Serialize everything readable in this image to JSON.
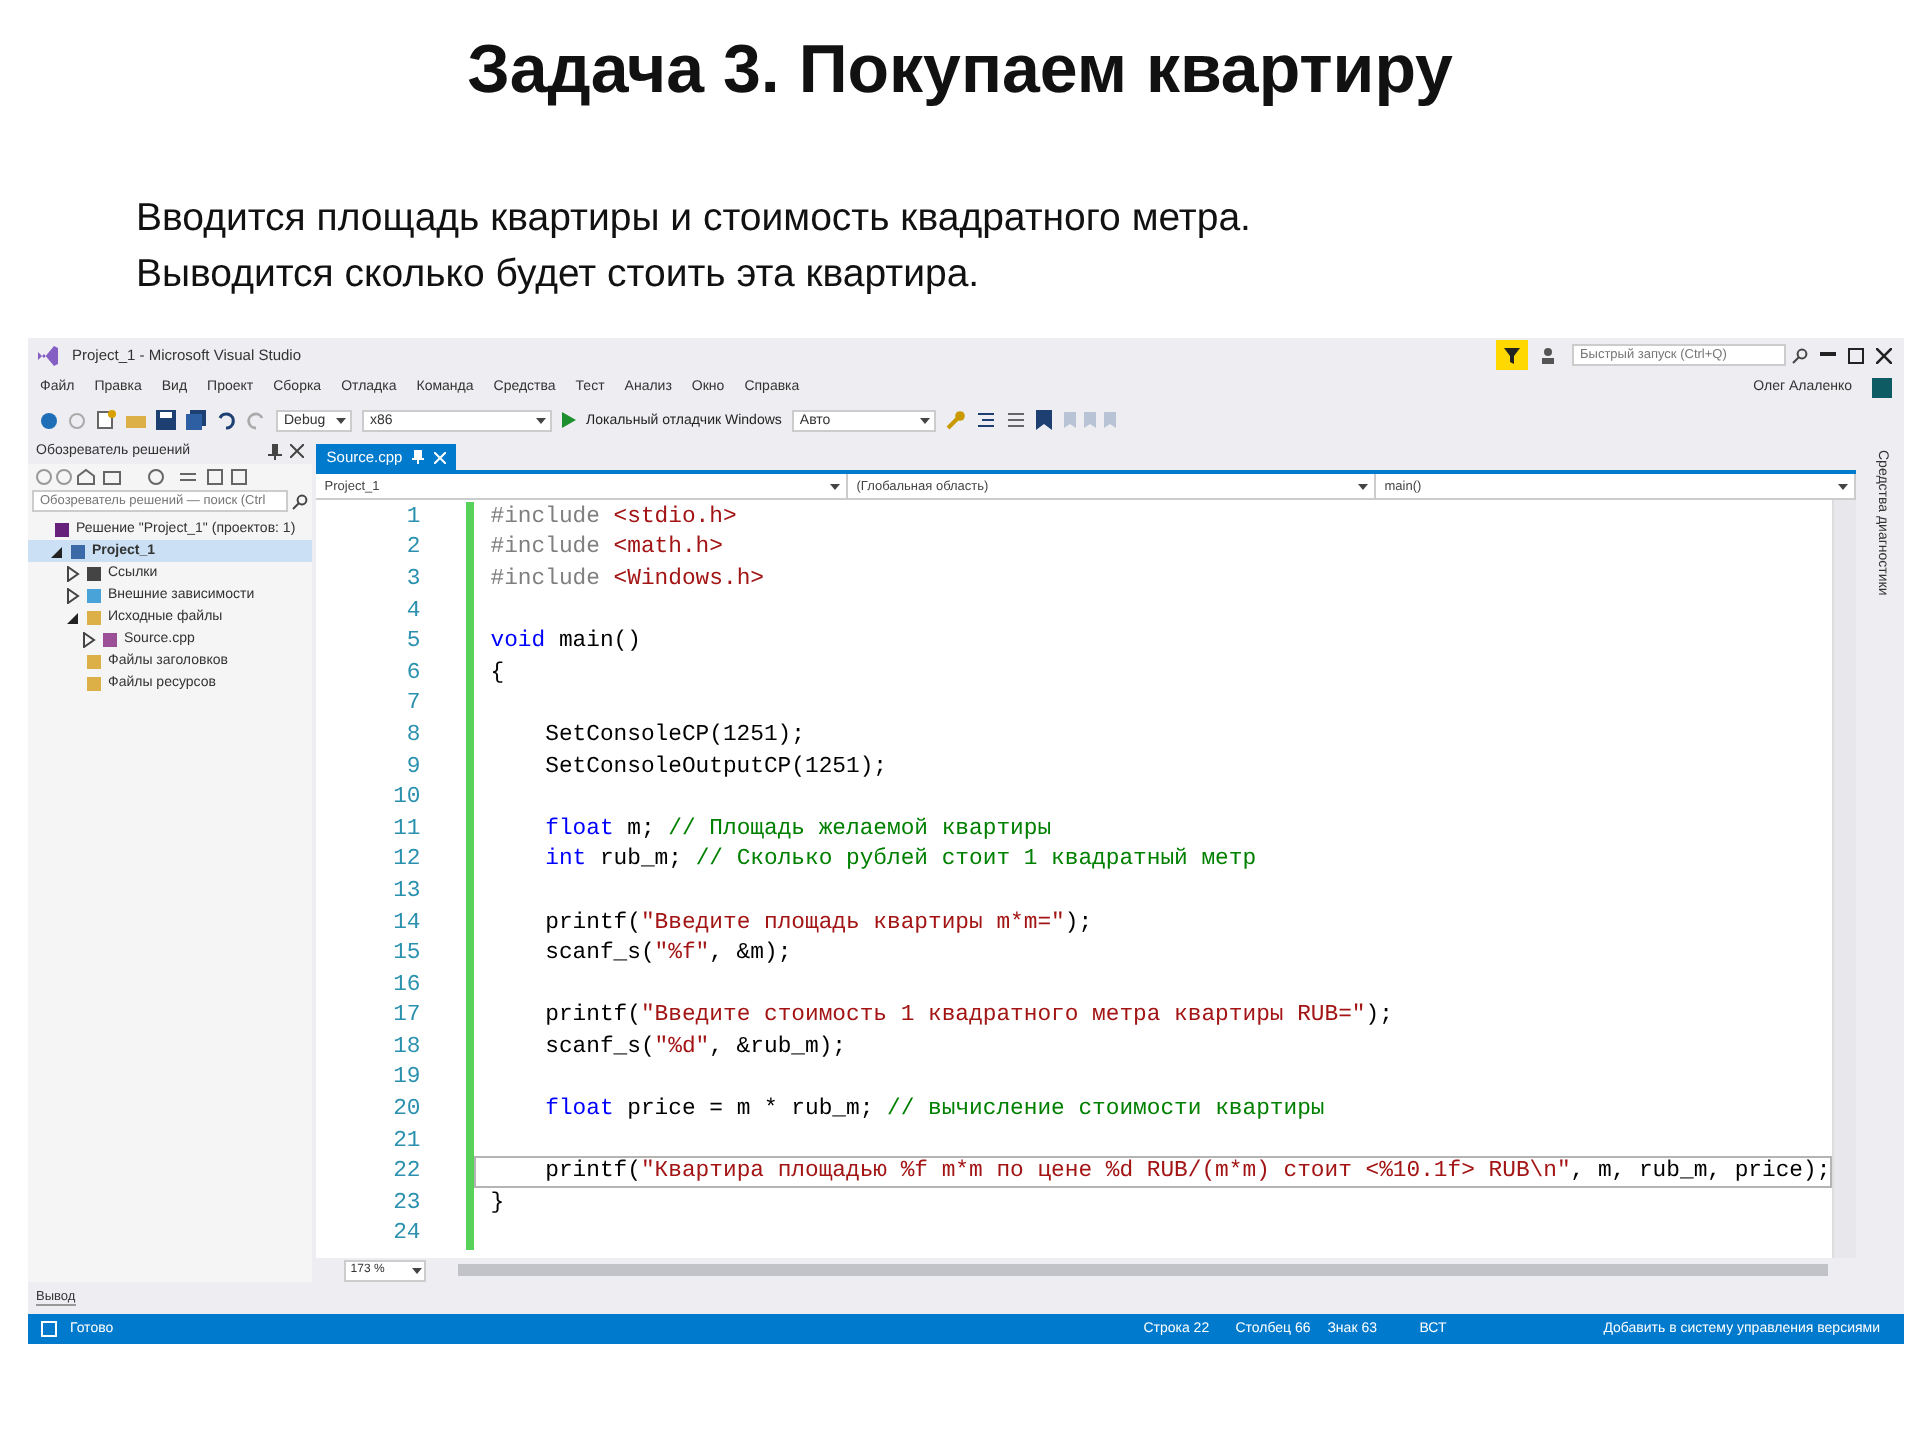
{
  "slide": {
    "title": "Задача 3. Покупаем квартиру",
    "lines": [
      "Вводится площадь квартиры и стоимость квадратного метра.",
      "Выводится сколько будет стоить эта квартира."
    ]
  },
  "window": {
    "title": "Project_1 - Microsoft Visual Studio",
    "quick_launch": {
      "placeholder": "Быстрый запуск (Ctrl+Q)"
    },
    "user": "Олег Алаленко"
  },
  "menu": [
    "Файл",
    "Правка",
    "Вид",
    "Проект",
    "Сборка",
    "Отладка",
    "Команда",
    "Средства",
    "Тест",
    "Анализ",
    "Окно",
    "Справка"
  ],
  "toolbar": {
    "configuration": "Debug",
    "platform": "x86",
    "debugger": "Локальный отладчик Windows",
    "mode": "Авто"
  },
  "solution_explorer": {
    "title": "Обозреватель решений",
    "search": {
      "placeholder": "Обозреватель решений — поиск (Ctrl"
    },
    "tree": [
      {
        "label": "Решение \"Project_1\" (проектов: 1)",
        "kind": "solution",
        "selected": false,
        "children": [
          {
            "label": "Project_1",
            "kind": "project",
            "expanded": true,
            "selected": true,
            "children": [
              {
                "label": "Ссылки",
                "kind": "references",
                "expanded": false,
                "selected": false
              },
              {
                "label": "Внешние зависимости",
                "kind": "external",
                "expanded": false,
                "selected": false
              },
              {
                "label": "Исходные файлы",
                "kind": "folder",
                "expanded": true,
                "selected": false,
                "children": [
                  {
                    "label": "Source.cpp",
                    "kind": "file",
                    "expanded": false,
                    "selected": false
                  }
                ]
              },
              {
                "label": "Файлы заголовков",
                "kind": "folder",
                "selected": false
              },
              {
                "label": "Файлы ресурсов",
                "kind": "folder",
                "selected": false
              }
            ]
          }
        ]
      }
    ]
  },
  "editor": {
    "tabs": [
      {
        "label": "Source.cpp",
        "selected": true
      }
    ],
    "navigation": {
      "project": "Project_1",
      "scope": "(Глобальная область)",
      "member": "main()"
    },
    "lines": [
      {
        "number": "1",
        "current": false,
        "segments": [
          {
            "kind": "pre",
            "text": "#include "
          },
          {
            "kind": "str",
            "text": "<stdio.h>"
          }
        ]
      },
      {
        "number": "2",
        "current": false,
        "segments": [
          {
            "kind": "pre",
            "text": "#include "
          },
          {
            "kind": "str",
            "text": "<math.h>"
          }
        ]
      },
      {
        "number": "3",
        "current": false,
        "segments": [
          {
            "kind": "pre",
            "text": "#include "
          },
          {
            "kind": "str",
            "text": "<Windows.h>"
          }
        ]
      },
      {
        "number": "4",
        "current": false
      },
      {
        "number": "5",
        "current": false,
        "segments": [
          {
            "kind": "kw",
            "text": "void"
          },
          {
            "kind": "plain",
            "text": " main()"
          }
        ]
      },
      {
        "number": "6",
        "current": false,
        "segments": [
          {
            "kind": "plain",
            "text": "{"
          }
        ]
      },
      {
        "number": "7",
        "current": false
      },
      {
        "number": "8",
        "current": false,
        "segments": [
          {
            "kind": "plain",
            "text": "    SetConsoleCP(1251);"
          }
        ]
      },
      {
        "number": "9",
        "current": false,
        "segments": [
          {
            "kind": "plain",
            "text": "    SetConsoleOutputCP(1251);"
          }
        ]
      },
      {
        "number": "10",
        "current": false
      },
      {
        "number": "11",
        "current": false,
        "segments": [
          {
            "kind": "kw",
            "text": "    float"
          },
          {
            "kind": "plain",
            "text": " m; "
          },
          {
            "kind": "com",
            "text": "// Площадь желаемой квартиры"
          }
        ]
      },
      {
        "number": "12",
        "current": false,
        "segments": [
          {
            "kind": "kw",
            "text": "    int"
          },
          {
            "kind": "plain",
            "text": " rub_m; "
          },
          {
            "kind": "com",
            "text": "// Сколько рублей стоит 1 квадратный метр"
          }
        ]
      },
      {
        "number": "13",
        "current": false
      },
      {
        "number": "14",
        "current": false,
        "segments": [
          {
            "kind": "plain",
            "text": "    printf("
          },
          {
            "kind": "str",
            "text": "\"Введите площадь квартиры m*m=\""
          },
          {
            "kind": "plain",
            "text": ");"
          }
        ]
      },
      {
        "number": "15",
        "current": false,
        "segments": [
          {
            "kind": "plain",
            "text": "    scanf_s("
          },
          {
            "kind": "str",
            "text": "\"%f\""
          },
          {
            "kind": "plain",
            "text": ", &m);"
          }
        ]
      },
      {
        "number": "16",
        "current": false
      },
      {
        "number": "17",
        "current": false,
        "segments": [
          {
            "kind": "plain",
            "text": "    printf("
          },
          {
            "kind": "str",
            "text": "\"Введите стоимость 1 квадратного метра квартиры RUB=\""
          },
          {
            "kind": "plain",
            "text": ");"
          }
        ]
      },
      {
        "number": "18",
        "current": false,
        "segments": [
          {
            "kind": "plain",
            "text": "    scanf_s("
          },
          {
            "kind": "str",
            "text": "\"%d\""
          },
          {
            "kind": "plain",
            "text": ", &rub_m);"
          }
        ]
      },
      {
        "number": "19",
        "current": false
      },
      {
        "number": "20",
        "current": false,
        "segments": [
          {
            "kind": "kw",
            "text": "    float"
          },
          {
            "kind": "plain",
            "text": " price = m * rub_m; "
          },
          {
            "kind": "com",
            "text": "// вычисление стоимости квартиры"
          }
        ]
      },
      {
        "number": "21",
        "current": false
      },
      {
        "number": "22",
        "current": true,
        "segments": [
          {
            "kind": "plain",
            "text": "    printf("
          },
          {
            "kind": "str",
            "text": "\"Квартира площадью %f m*m по цене %d RUB/(m*m) стоит <%10.1f> RUB\\n\""
          },
          {
            "kind": "plain",
            "text": ", m, rub_m, price);"
          }
        ]
      },
      {
        "number": "23",
        "current": false,
        "segments": [
          {
            "kind": "plain",
            "text": "}"
          }
        ]
      },
      {
        "number": "24",
        "current": false
      }
    ],
    "zoom": "173 %"
  },
  "side_strip": "Средства диагностики",
  "output_tab": "Вывод",
  "status_bar": {
    "state": "Готово",
    "line": "Строка 22",
    "column": "Столбец 66",
    "char": "Знак 63",
    "mode": "ВСТ",
    "source_control": "Добавить в систему управления версиями"
  }
}
